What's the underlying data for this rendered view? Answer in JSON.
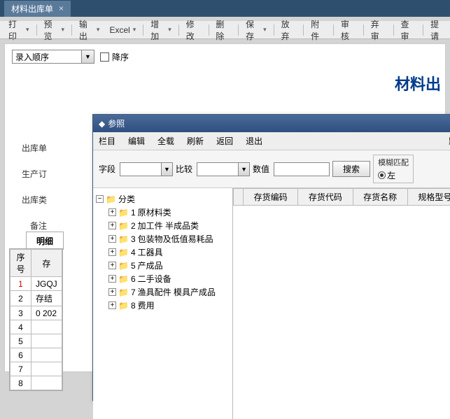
{
  "app": {
    "tab_title": "材料出库单"
  },
  "toolbar": {
    "print": "打印",
    "preview": "预览",
    "output": "输出",
    "excel": "Excel",
    "add": "增加",
    "modify": "修改",
    "delete": "删除",
    "save": "保存",
    "abandon": "放弃",
    "attach": "附件",
    "audit": "审核",
    "unaudit": "弃审",
    "query": "查审",
    "submit": "提请"
  },
  "controls": {
    "order_combo": "录入顺序",
    "desc_label": "降序"
  },
  "page_title": "材料出",
  "form": {
    "f1": "出库单",
    "f2": "生产订",
    "f3": "出库类",
    "f4": "备注"
  },
  "detail_tab": "明细",
  "grid": {
    "col_seq": "序号",
    "col_stock": "存",
    "col_stock2": "存结",
    "row1_stock": "JGQJ",
    "row3_val": "0 202"
  },
  "popup": {
    "title": "参照",
    "menu": {
      "column": "栏目",
      "edit": "编辑",
      "loadall": "全载",
      "refresh": "刷新",
      "back": "返回",
      "exit": "退出",
      "default": "默"
    },
    "search": {
      "field_lbl": "字段",
      "compare_lbl": "比较",
      "value_lbl": "数值",
      "search_btn": "搜索",
      "fuzzy_title": "模糊匹配",
      "opt_left": "左",
      "opt_right": ""
    },
    "tree": {
      "root": "分类",
      "items": [
        {
          "code": "1",
          "label": "原材料类"
        },
        {
          "code": "2",
          "label": "加工件 半成品类"
        },
        {
          "code": "3",
          "label": "包装物及低值易耗品"
        },
        {
          "code": "4",
          "label": "工器具"
        },
        {
          "code": "5",
          "label": "产成品"
        },
        {
          "code": "6",
          "label": "二手设备"
        },
        {
          "code": "7",
          "label": "渔具配件  模具产成品"
        },
        {
          "code": "8",
          "label": "费用"
        }
      ]
    },
    "list_cols": {
      "c1": "存货编码",
      "c2": "存货代码",
      "c3": "存货名称",
      "c4": "规格型号"
    }
  }
}
